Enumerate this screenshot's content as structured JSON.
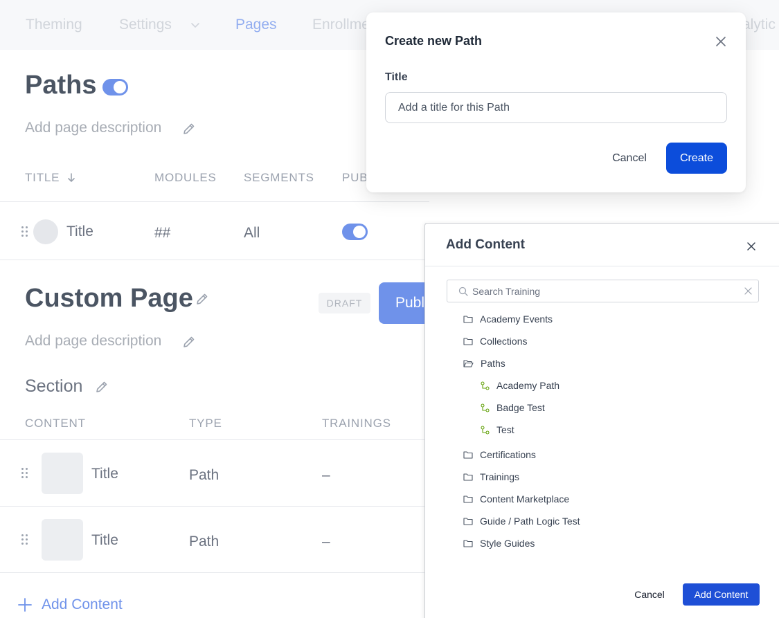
{
  "nav": {
    "items": [
      {
        "label": "Theming",
        "active": false
      },
      {
        "label": "Settings",
        "active": false
      },
      {
        "label": "Pages",
        "active": true
      },
      {
        "label": "Enrollme",
        "active": false
      },
      {
        "label": "alytic",
        "active": false
      }
    ]
  },
  "paths_section": {
    "title": "Paths",
    "published": true,
    "description_placeholder": "Add page description",
    "columns": [
      "TITLE",
      "MODULES",
      "SEGMENTS",
      "PUB"
    ],
    "rows": [
      {
        "title": "Title",
        "modules": "##",
        "segments": "All",
        "published": true
      }
    ]
  },
  "custom_page": {
    "title": "Custom Page",
    "status_badge": "DRAFT",
    "publish_label": "Publi",
    "description_placeholder": "Add page description",
    "section_title": "Section",
    "columns": [
      "CONTENT",
      "TYPE",
      "TRAININGS"
    ],
    "rows": [
      {
        "title": "Title",
        "type": "Path",
        "trainings": "–"
      },
      {
        "title": "Title",
        "type": "Path",
        "trainings": "–"
      }
    ],
    "add_content_label": "Add Content"
  },
  "create_path_modal": {
    "title": "Create new Path",
    "field_label": "Title",
    "placeholder": "Add a title for this Path",
    "value": "",
    "cancel_label": "Cancel",
    "create_label": "Create"
  },
  "add_content_panel": {
    "title": "Add Content",
    "search_placeholder": "Search Training",
    "tree": [
      {
        "label": "Academy Events",
        "kind": "folder",
        "icon": "folder-icon"
      },
      {
        "label": "Collections",
        "kind": "folder",
        "icon": "folder-icon"
      },
      {
        "label": "Paths",
        "kind": "folder-open",
        "icon": "folder-open-icon"
      },
      {
        "label": "Academy Path",
        "kind": "path",
        "icon": "path-icon"
      },
      {
        "label": "Badge Test",
        "kind": "path",
        "icon": "path-icon"
      },
      {
        "label": "Test",
        "kind": "path",
        "icon": "path-icon"
      },
      {
        "label": "Certifications",
        "kind": "folder",
        "icon": "folder-icon"
      },
      {
        "label": "Trainings",
        "kind": "folder",
        "icon": "folder-icon"
      },
      {
        "label": "Content Marketplace",
        "kind": "folder",
        "icon": "folder-icon"
      },
      {
        "label": "Guide / Path Logic Test",
        "kind": "folder",
        "icon": "folder-icon"
      },
      {
        "label": "Style Guides",
        "kind": "folder",
        "icon": "folder-icon"
      }
    ],
    "cancel_label": "Cancel",
    "add_label": "Add Content"
  },
  "colors": {
    "primary": "#0c4ddb",
    "primary_muted": "#6f92ea",
    "path_icon": "#65a30d"
  }
}
